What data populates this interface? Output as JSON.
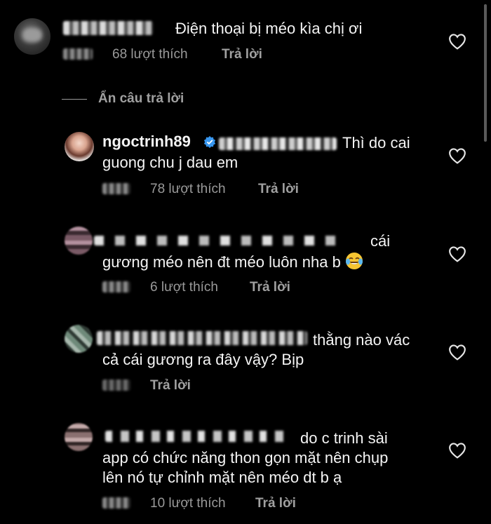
{
  "comments": [
    {
      "text_line_1": "Điện thoại bị méo kìa chị ơi",
      "likes": "68 lượt thích",
      "reply": "Trả lời"
    }
  ],
  "hide_replies_label": "Ẩn câu trả lời",
  "replies": [
    {
      "username": "ngoctrinh89",
      "text_line_1": "Thì do cai",
      "text_line_2": "guong chu j dau em",
      "likes": "78 lượt thích",
      "reply": "Trả lời",
      "verified": true
    },
    {
      "text_line_1": "cái",
      "text_line_2": "gương méo nên đt méo luôn nha b",
      "emoji": "tears-of-joy-emoji",
      "likes": "6 lượt thích",
      "reply": "Trả lời"
    },
    {
      "text_line_1": "thằng nào vác",
      "text_line_2": "cả cái gương ra đây vậy? Bịp",
      "reply": "Trả lời"
    },
    {
      "text_line_1": "do c trinh sài",
      "text_line_2": "app có chức năng thon gọn mặt nên chụp",
      "text_line_3": "lên nó tự  chỉnh mặt nên méo dt b ạ",
      "likes": "10 lượt thích",
      "reply": "Trả lời"
    }
  ],
  "colors": {
    "background": "#000000",
    "text": "#f4f4f4",
    "secondary": "#9a9a9a",
    "verified": "#3897f0"
  }
}
